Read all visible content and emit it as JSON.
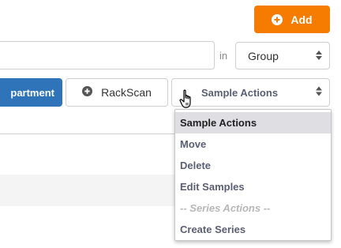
{
  "toolbar": {
    "add_label": "Add",
    "in_label": "in",
    "group_select_value": "Group"
  },
  "actions": {
    "department_label": "partment",
    "rackscan_label": "RackScan",
    "sample_actions_value": "Sample Actions"
  },
  "dropdown": {
    "items": [
      {
        "label": "Sample Actions",
        "state": "selected"
      },
      {
        "label": "Move",
        "state": "enabled"
      },
      {
        "label": "Delete",
        "state": "enabled"
      },
      {
        "label": "Edit Samples",
        "state": "enabled"
      },
      {
        "label": "-- Series Actions --",
        "state": "disabled"
      },
      {
        "label": "Create Series",
        "state": "enabled"
      }
    ]
  },
  "colors": {
    "accent_orange": "#f57c00",
    "primary_blue": "#2f74b8",
    "selected_bg": "#dedee3"
  },
  "icons": {
    "add": "plus-circle-icon",
    "rackscan": "plus-circle-icon",
    "select_arrows": "sort-arrows-icon",
    "cursor": "hand-pointer-icon"
  }
}
